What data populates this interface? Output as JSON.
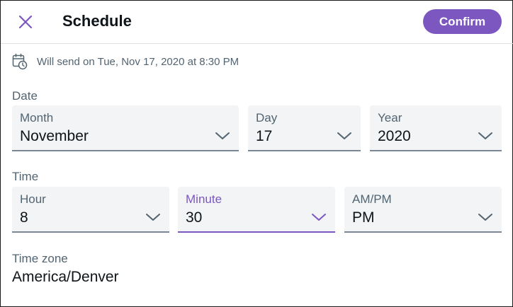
{
  "header": {
    "title": "Schedule",
    "confirm_label": "Confirm",
    "close_icon": "close-icon"
  },
  "send_info": {
    "icon": "calendar-clock-icon",
    "text": "Will send on Tue, Nov 17, 2020 at 8:30 PM"
  },
  "date": {
    "section_label": "Date",
    "month": {
      "label": "Month",
      "value": "November"
    },
    "day": {
      "label": "Day",
      "value": "17"
    },
    "year": {
      "label": "Year",
      "value": "2020"
    }
  },
  "time": {
    "section_label": "Time",
    "hour": {
      "label": "Hour",
      "value": "8"
    },
    "minute": {
      "label": "Minute",
      "value": "30"
    },
    "ampm": {
      "label": "AM/PM",
      "value": "PM"
    }
  },
  "timezone": {
    "label": "Time zone",
    "value": "America/Denver"
  },
  "colors": {
    "accent": "#7c57c0",
    "field_bg": "#f2f4f6",
    "secondary_text": "#536471",
    "primary_text": "#0f1419"
  }
}
